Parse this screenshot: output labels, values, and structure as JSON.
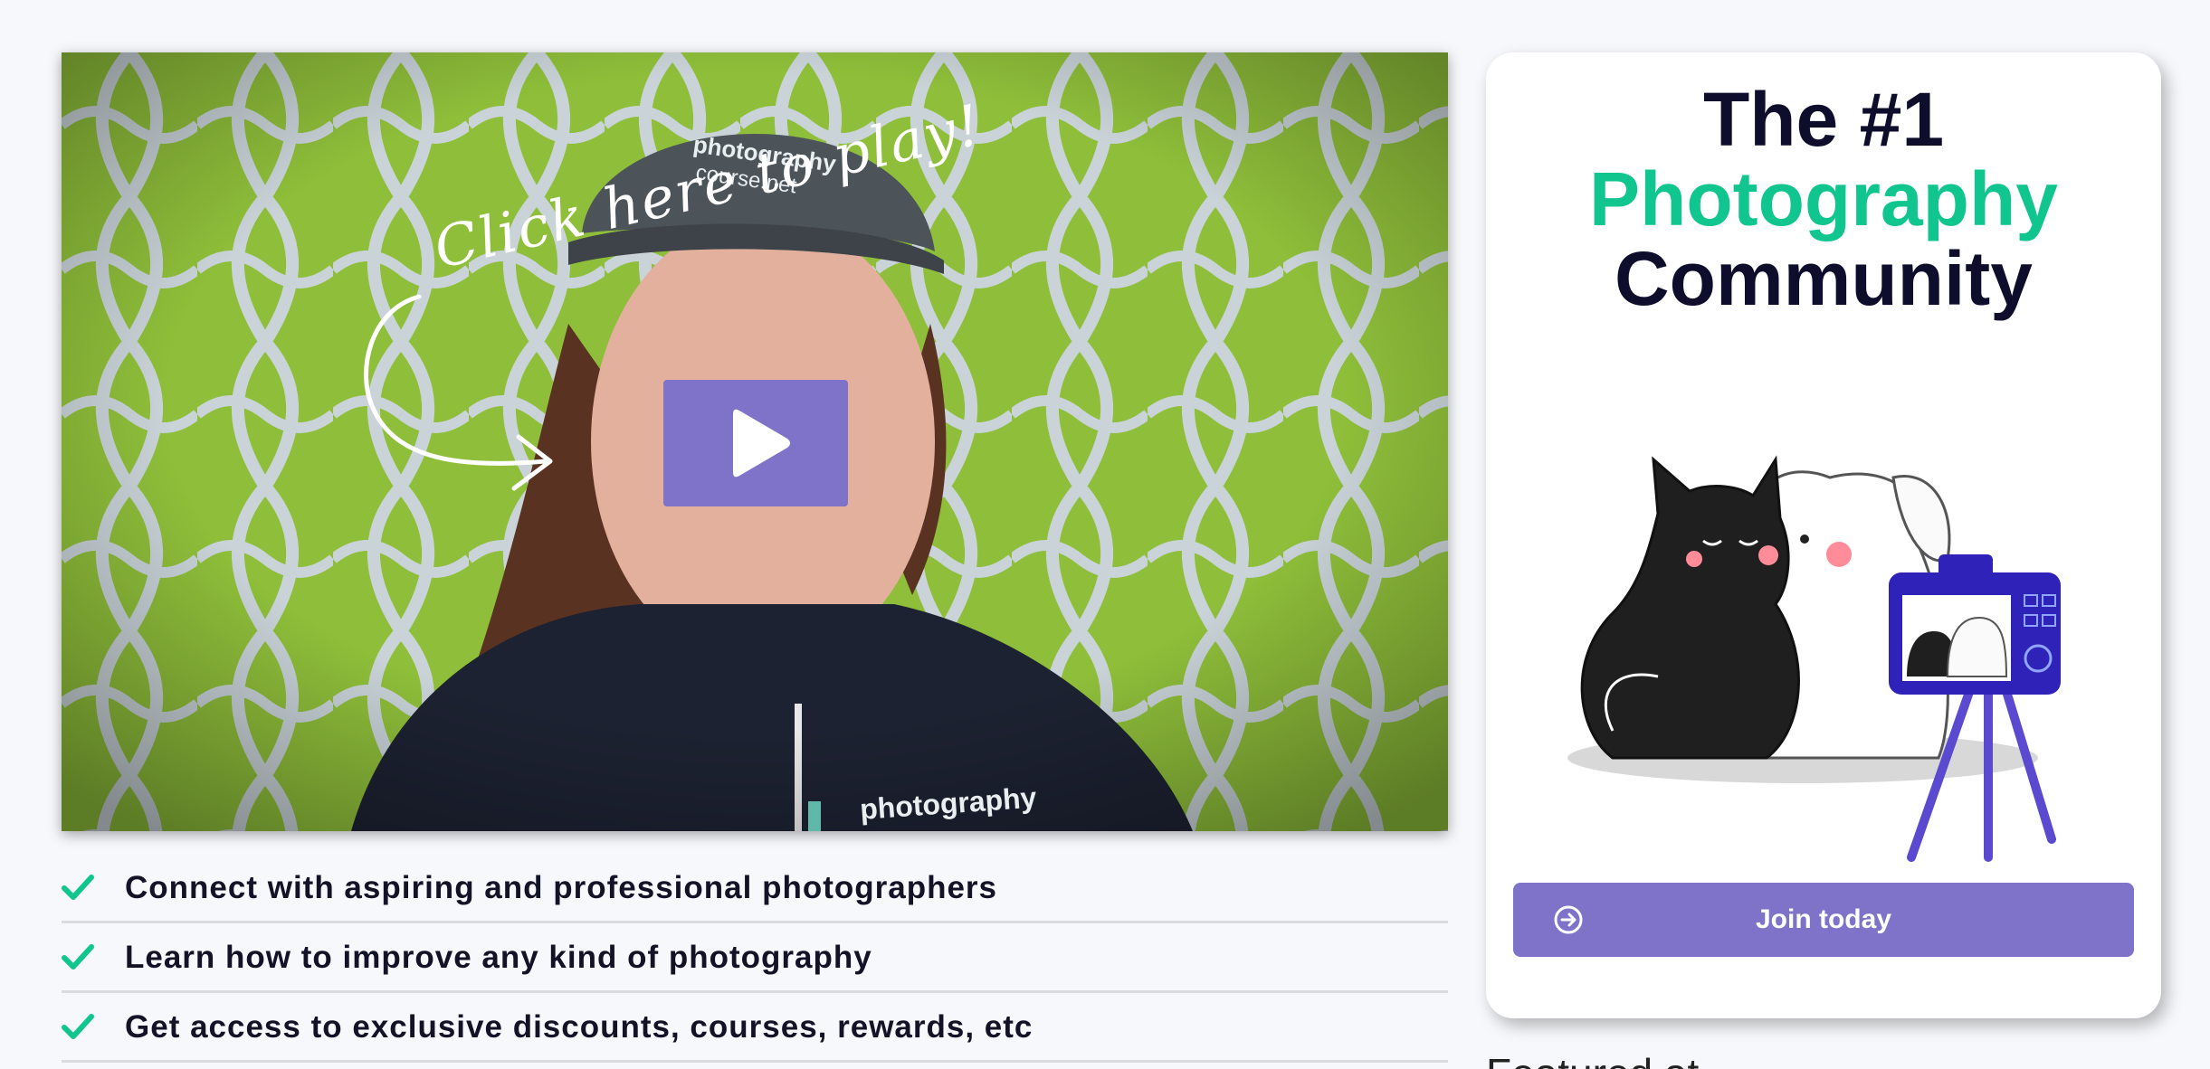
{
  "video": {
    "hint": "Click here to play!",
    "cap_logo_line1": "photography",
    "cap_logo_line2": "course.net",
    "hoodie_logo": "photography"
  },
  "features": [
    "Connect with aspiring and professional photographers",
    "Learn how to improve any kind of photography",
    "Get access to exclusive discounts, courses, rewards, etc"
  ],
  "card": {
    "headline_line1": "The #1",
    "headline_line2": "Photography",
    "headline_line3": "Community",
    "join_label": "Join today"
  },
  "below": "Featured at",
  "colors": {
    "accent_purple": "#7f73c9",
    "accent_green": "#11c58f",
    "headline_dark": "#0e0d2b"
  }
}
